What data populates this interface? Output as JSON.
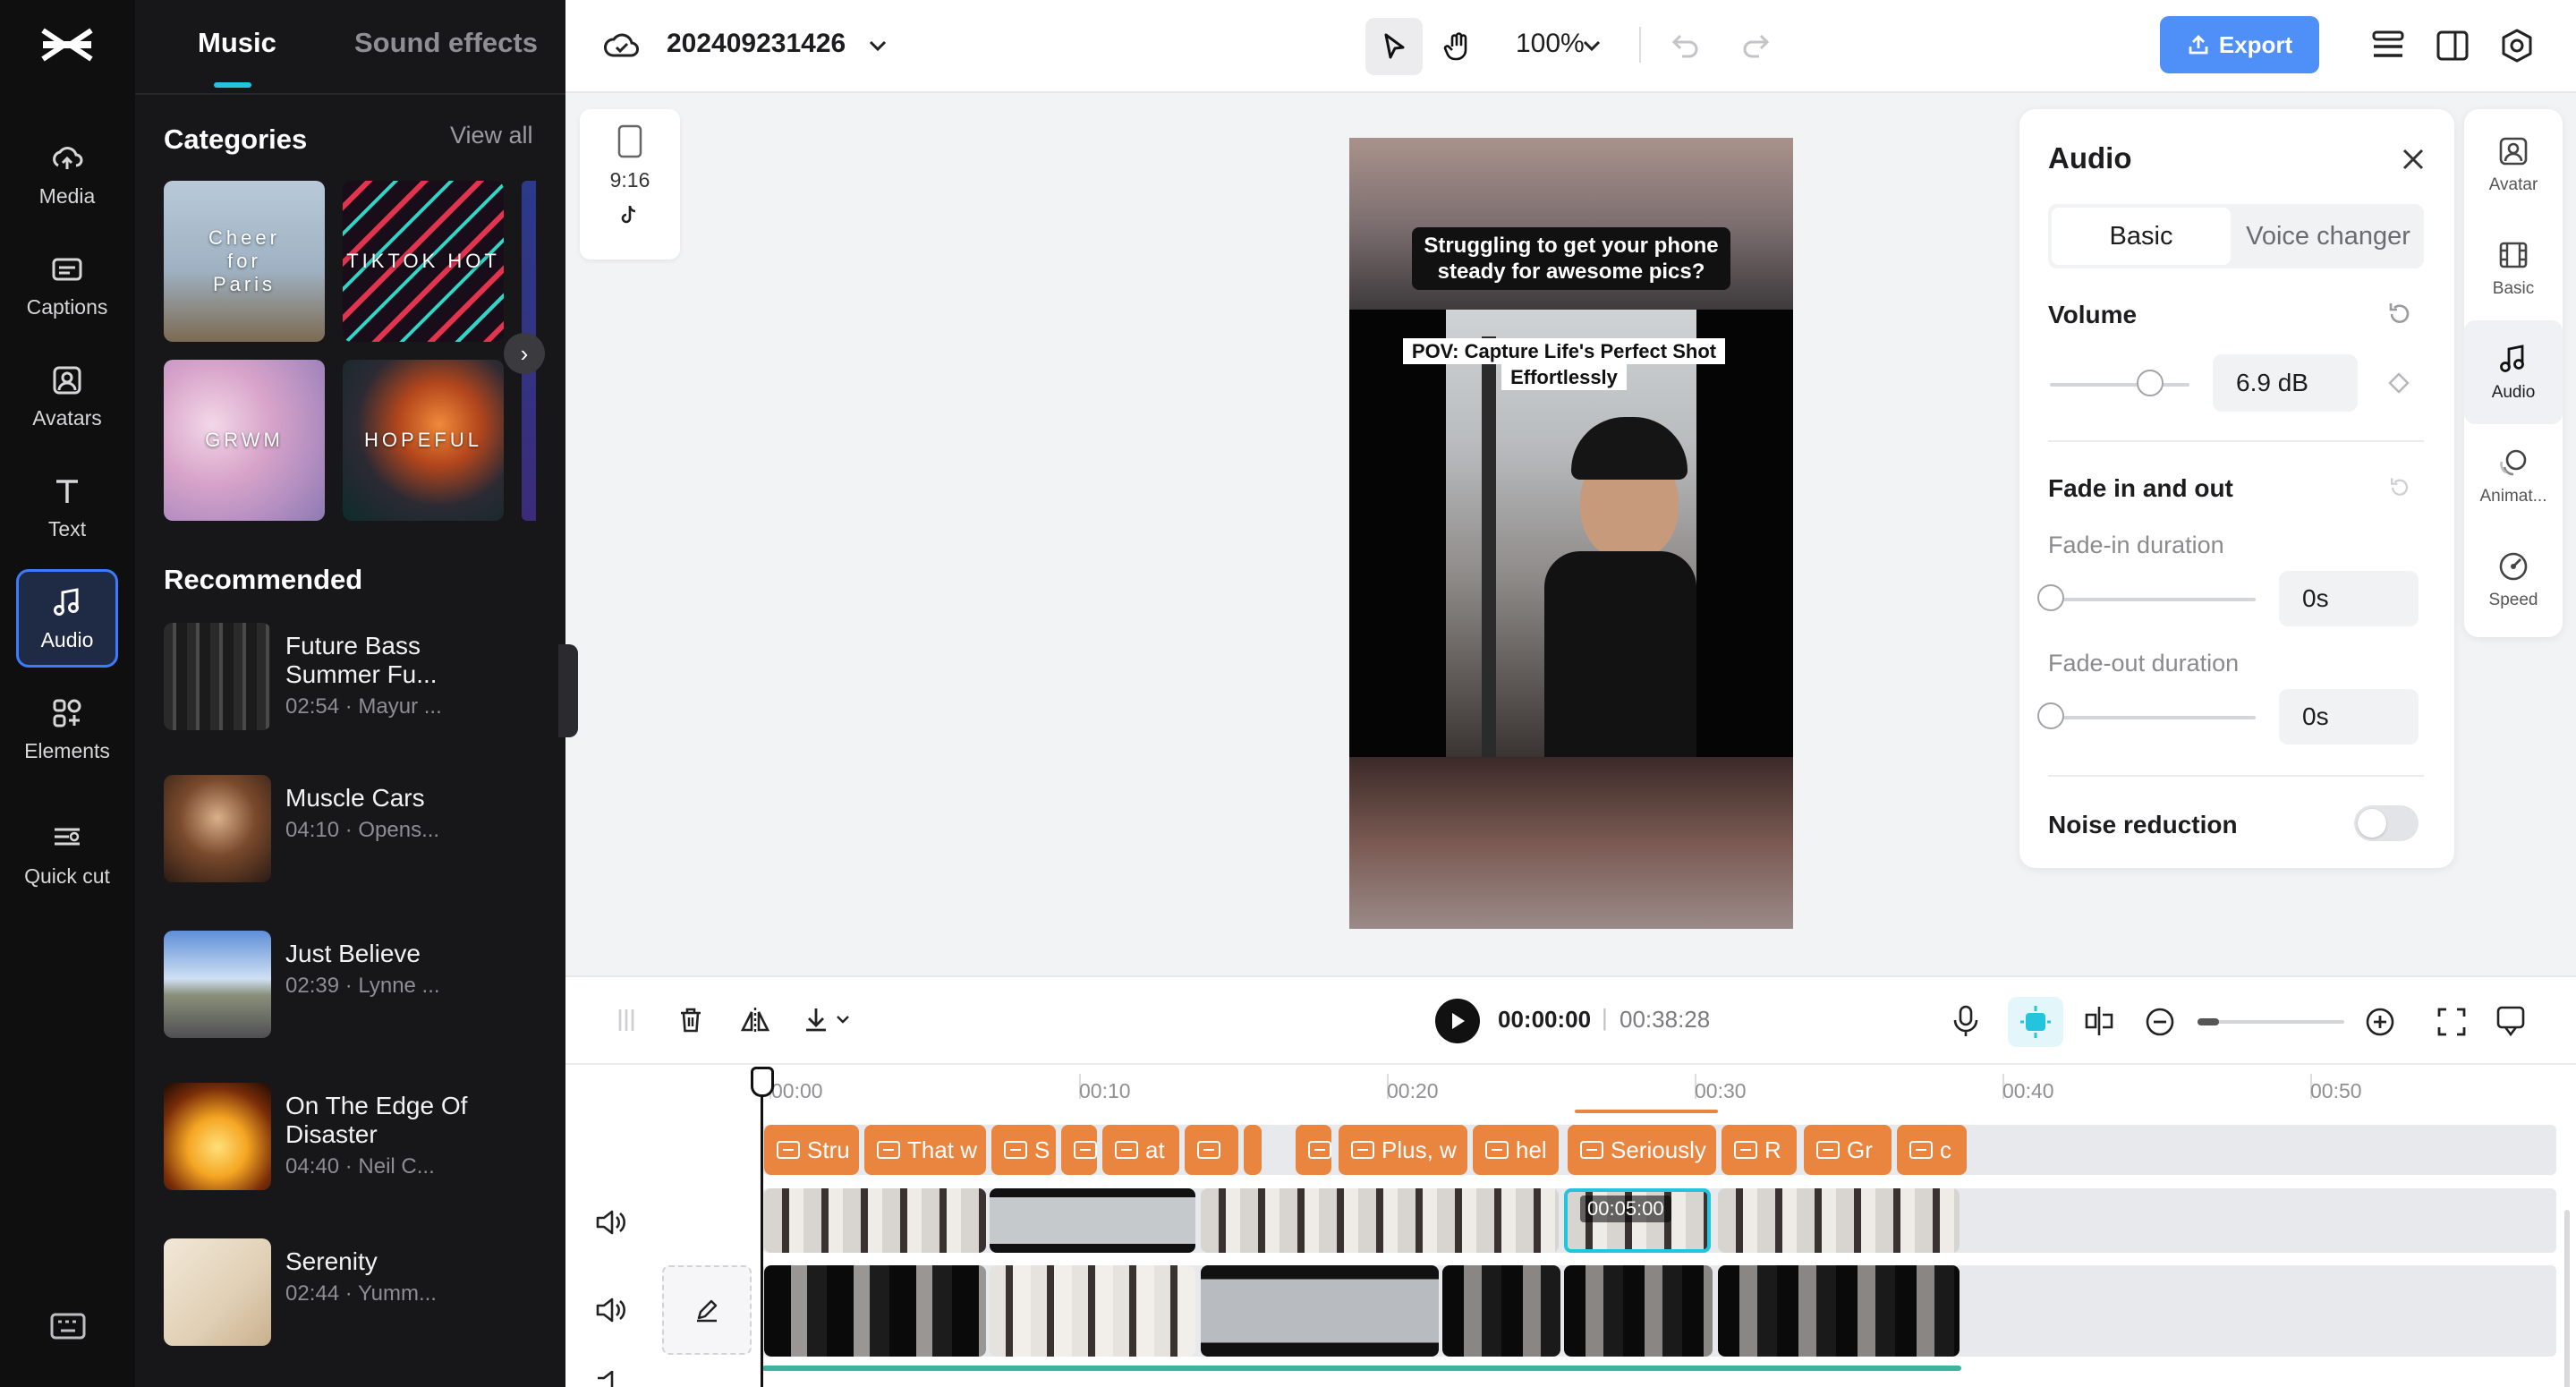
{
  "rail": {
    "items": [
      {
        "label": "Media",
        "icon": "cloud-upload-icon"
      },
      {
        "label": "Captions",
        "icon": "captions-icon"
      },
      {
        "label": "Avatars",
        "icon": "avatar-icon"
      },
      {
        "label": "Text",
        "icon": "text-icon"
      },
      {
        "label": "Audio",
        "icon": "music-note-icon"
      },
      {
        "label": "Elements",
        "icon": "elements-icon"
      },
      {
        "label": "Quick cut",
        "icon": "quick-cut-icon"
      }
    ],
    "active": "Audio"
  },
  "panel": {
    "tabs": {
      "music": "Music",
      "sfx": "Sound effects"
    },
    "categories_title": "Categories",
    "view_all": "View all",
    "categories": [
      "Cheer for Paris",
      "TIKTOK HOT",
      "GRWM",
      "HOPEFUL"
    ],
    "recommended_title": "Recommended",
    "tracks": [
      {
        "title": "Future Bass Summer Fu...",
        "meta": "02:54 · Mayur ..."
      },
      {
        "title": "Muscle Cars",
        "meta": "04:10 · Opens..."
      },
      {
        "title": "Just Believe",
        "meta": "02:39 · Lynne ..."
      },
      {
        "title": "On The Edge Of Disaster",
        "meta": "04:40 · Neil C..."
      },
      {
        "title": "Serenity",
        "meta": "02:44 · Yumm..."
      }
    ]
  },
  "topbar": {
    "project_name": "202409231426",
    "zoom": "100%",
    "export_label": "Export"
  },
  "canvas": {
    "ratio": "9:16",
    "caption_top": "Struggling to get your phone steady for awesome pics?",
    "caption_mid": "POV: Capture Life's Perfect Shot Effortlessly"
  },
  "audio_panel": {
    "title": "Audio",
    "seg_basic": "Basic",
    "seg_voice": "Voice changer",
    "volume_label": "Volume",
    "volume_value": "6.9 dB",
    "volume_level": 0.72,
    "fade_label": "Fade in and out",
    "fade_in_label": "Fade-in duration",
    "fade_in_value": "0s",
    "fade_out_label": "Fade-out duration",
    "fade_out_value": "0s",
    "noise_label": "Noise reduction"
  },
  "right_rail": [
    {
      "label": "Avatar",
      "icon": "avatar-icon"
    },
    {
      "label": "Basic",
      "icon": "film-icon"
    },
    {
      "label": "Audio",
      "icon": "music-note-icon"
    },
    {
      "label": "Animat...",
      "icon": "animation-icon"
    },
    {
      "label": "Speed",
      "icon": "speed-icon"
    }
  ],
  "timeline": {
    "current_time": "00:00:00",
    "separator": "|",
    "total_time": "00:38:28",
    "ruler": [
      "00:00",
      "00:10",
      "00:20",
      "00:30",
      "00:40",
      "00:50"
    ],
    "caption_clips": [
      "Stru",
      "That w",
      "S",
      "",
      "at",
      "",
      "",
      "",
      "Plus, w",
      "hel",
      "Seriously",
      "R",
      "Gr",
      "c"
    ],
    "selected_clip_time": "00:05:00"
  },
  "colors": {
    "accent": "#22c5dd",
    "export": "#4e8ff8",
    "caption_clip": "#e9853f",
    "rail_bg": "#0f0f10",
    "panel_bg": "#17171a"
  }
}
